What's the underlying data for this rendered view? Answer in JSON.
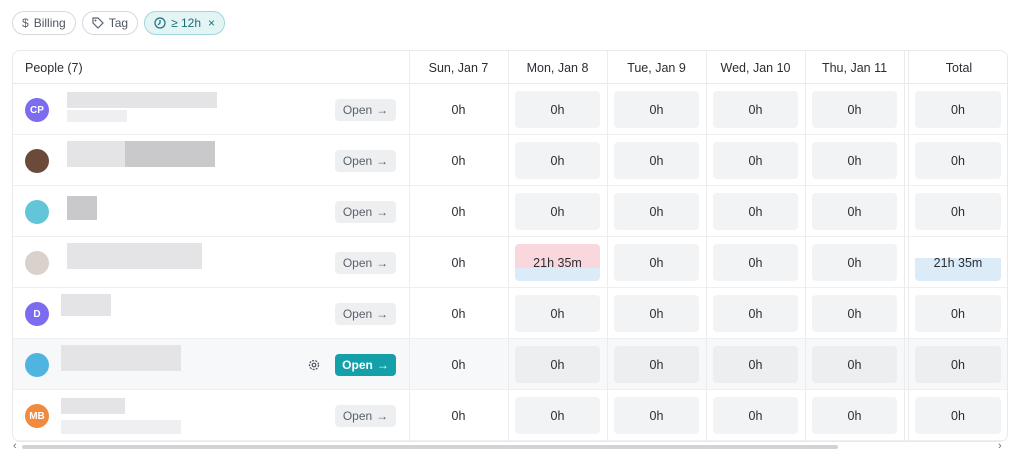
{
  "filters": {
    "billing": {
      "icon": "dollar-icon",
      "label": "Billing"
    },
    "tag": {
      "icon": "tag-icon",
      "label": "Tag"
    },
    "duration": {
      "icon": "clock-icon",
      "label": "≥ 12h",
      "close": "×"
    }
  },
  "table": {
    "people_header": "People (7)",
    "days": [
      "Sun, Jan 7",
      "Mon, Jan 8",
      "Tue, Jan 9",
      "Wed, Jan 10",
      "Thu, Jan 11"
    ],
    "total_header": "Total",
    "open_label": "Open",
    "open_arrow": "→",
    "rows": [
      {
        "initials": "CP",
        "avatar_color": "#7b6cf0",
        "values": [
          "0h",
          "0h",
          "0h",
          "0h",
          "0h"
        ],
        "total": "0h"
      },
      {
        "initials": "",
        "avatar_color": "#6b4a3a",
        "values": [
          "0h",
          "0h",
          "0h",
          "0h",
          "0h"
        ],
        "total": "0h"
      },
      {
        "initials": "",
        "avatar_color": "#62c5d8",
        "values": [
          "0h",
          "0h",
          "0h",
          "0h",
          "0h"
        ],
        "total": "0h"
      },
      {
        "initials": "",
        "avatar_color": "#d9d1cc",
        "values": [
          "0h",
          "21h 35m",
          "0h",
          "0h",
          "0h"
        ],
        "total": "21h 35m"
      },
      {
        "initials": "D",
        "avatar_color": "#7b6cf0",
        "values": [
          "0h",
          "0h",
          "0h",
          "0h",
          "0h"
        ],
        "total": "0h"
      },
      {
        "initials": "",
        "avatar_color": "#4fb5e0",
        "values": [
          "0h",
          "0h",
          "0h",
          "0h",
          "0h"
        ],
        "total": "0h"
      },
      {
        "initials": "MB",
        "avatar_color": "#f08a3c",
        "values": [
          "0h",
          "0h",
          "0h",
          "0h",
          "0h"
        ],
        "total": "0h"
      }
    ]
  },
  "colors": {
    "accent": "#14a0a8",
    "alert": "#f8d8dc",
    "info": "#dbecf8"
  }
}
